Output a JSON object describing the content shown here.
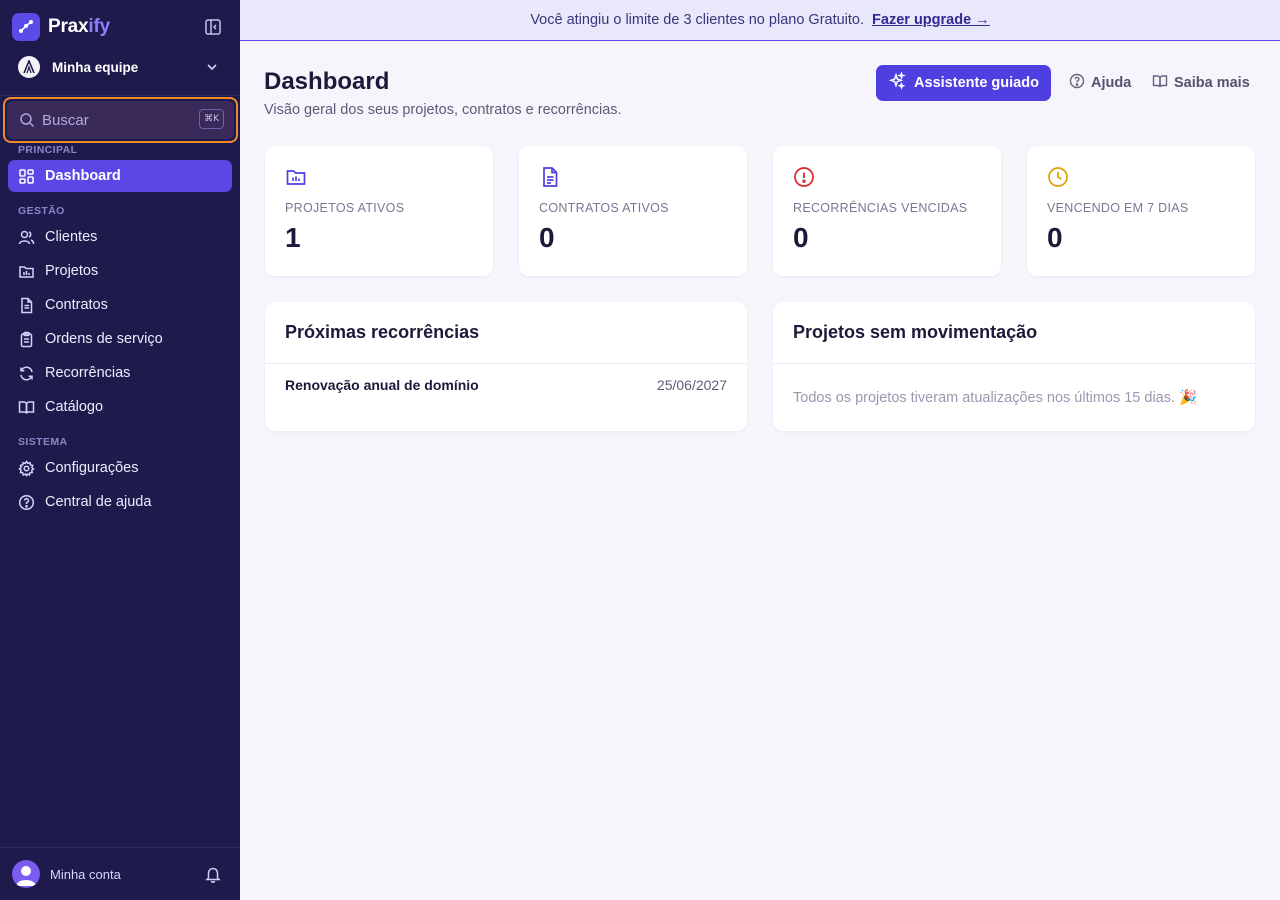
{
  "brand": {
    "name_part1": "Prax",
    "name_part2": "ify"
  },
  "team": {
    "name": "Minha equipe"
  },
  "search": {
    "placeholder": "Buscar",
    "shortcut": "⌘K"
  },
  "sidebar": {
    "sections": {
      "principal": "PRINCIPAL",
      "gestao": "GESTÃO",
      "sistema": "SISTEMA"
    },
    "items": {
      "dashboard": "Dashboard",
      "clientes": "Clientes",
      "projetos": "Projetos",
      "contratos": "Contratos",
      "ordens": "Ordens de serviço",
      "recorrencias": "Recorrências",
      "catalogo": "Catálogo",
      "configuracoes": "Configurações",
      "ajuda": "Central de ajuda"
    },
    "account": "Minha conta"
  },
  "banner": {
    "text": "Você atingiu o limite de 3 clientes no plano Gratuito.",
    "link": "Fazer upgrade →"
  },
  "header": {
    "title": "Dashboard",
    "subtitle": "Visão geral dos seus projetos, contratos e recorrências.",
    "primary_button": "Assistente guiado",
    "help": "Ajuda",
    "learn_more": "Saiba mais"
  },
  "stats": [
    {
      "label": "PROJETOS ATIVOS",
      "value": "1"
    },
    {
      "label": "CONTRATOS ATIVOS",
      "value": "0"
    },
    {
      "label": "RECORRÊNCIAS VENCIDAS",
      "value": "0"
    },
    {
      "label": "VENCENDO EM 7 DIAS",
      "value": "0"
    }
  ],
  "upcoming": {
    "title": "Próximas recorrências",
    "rows": [
      {
        "name": "Renovação anual de domínio",
        "date": "25/06/2027"
      }
    ]
  },
  "idle_projects": {
    "title": "Projetos sem movimentação",
    "empty": "Todos os projetos tiveram atualizações nos últimos 15 dias. 🎉"
  },
  "colors": {
    "sidebar": "#1e1a4b",
    "accent": "#5a47e6",
    "focus_ring": "#ef8a2f",
    "stat_projects": "#4f3fe0",
    "stat_contracts": "#4f3fe0",
    "stat_overdue": "#dc2626",
    "stat_due_soon": "#e0a100"
  }
}
